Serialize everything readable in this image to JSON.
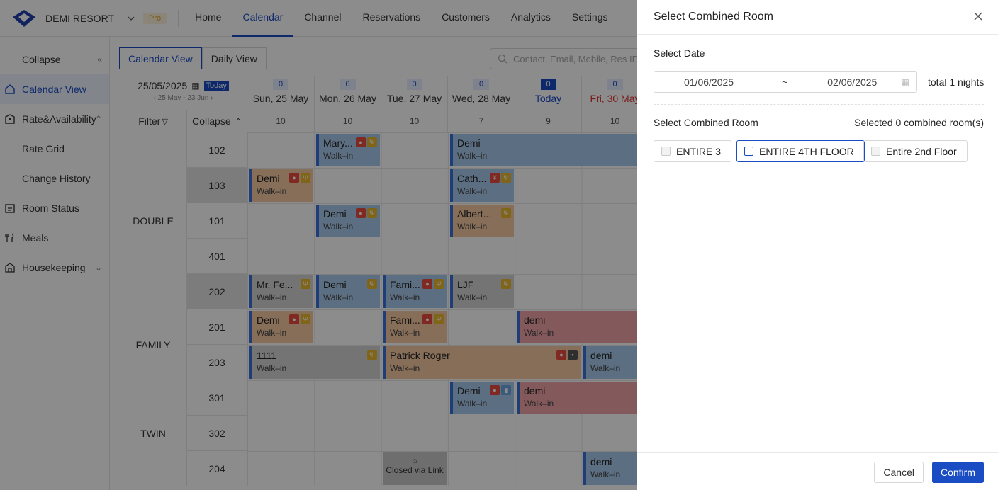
{
  "app": {
    "brand": "DEMI RESORT",
    "pro_badge": "Pro"
  },
  "nav": [
    "Home",
    "Calendar",
    "Channel",
    "Reservations",
    "Customers",
    "Analytics",
    "Settings"
  ],
  "sidebar": {
    "collapse": "Collapse",
    "items": [
      "Calendar View",
      "Rate&Availability",
      "Rate Grid",
      "Change History",
      "Room Status",
      "Meals",
      "Housekeeping"
    ]
  },
  "toolbar": {
    "calendar_view": "Calendar View",
    "daily_view": "Daily View",
    "search_placeholder": "Contact, Email, Mobile, Res ID"
  },
  "calendar": {
    "current_date": "25/05/2025",
    "today_btn": "Today",
    "range": "25 May - 23 Jun",
    "filter": "Filter",
    "collapse": "Collapse",
    "days": [
      {
        "count": "0",
        "label": "Sun, 25 May",
        "avail": "10"
      },
      {
        "count": "0",
        "label": "Mon, 26 May",
        "avail": "10"
      },
      {
        "count": "0",
        "label": "Tue, 27 May",
        "avail": "10"
      },
      {
        "count": "0",
        "label": "Wed, 28 May",
        "avail": "7"
      },
      {
        "count": "0",
        "label": "Today",
        "avail": "9"
      },
      {
        "count": "0",
        "label": "Fri, 30 May",
        "avail": "10"
      }
    ],
    "room_types": [
      "DOUBLE",
      "FAMILY",
      "TWIN"
    ],
    "rooms": [
      "102",
      "103",
      "101",
      "401",
      "202",
      "201",
      "203",
      "301",
      "302",
      "204"
    ],
    "walk_in": "Walk–in",
    "bookings": {
      "b1": "Mary...",
      "b2": "Demi",
      "b3": "Demi",
      "b4": "Cath...",
      "b5": "Demi",
      "b6": "Albert...",
      "b7": "Mr. Fe...",
      "b8": "Demi",
      "b9": "Fami...",
      "b10": "LJF",
      "b11": "Demi",
      "b12": "Fami...",
      "b13": "demi",
      "b14": "1111",
      "b15": "Patrick Roger",
      "b16": "demi",
      "b17": "Demi",
      "b18": "demi",
      "b19": "demi"
    },
    "closed": "Closed via Link"
  },
  "drawer": {
    "title": "Select Combined Room",
    "select_date": "Select Date",
    "start_date": "01/06/2025",
    "tilde": "~",
    "end_date": "02/06/2025",
    "nights": "total 1 nights",
    "select_room": "Select Combined Room",
    "selected_count": "Selected 0 combined room(s)",
    "rooms": [
      "ENTIRE 3",
      "ENTIRE 4TH FLOOR",
      "Entire 2nd Floor"
    ],
    "cancel": "Cancel",
    "confirm": "Confirm"
  },
  "colors": {
    "accent": "#1a4cc4",
    "overlay": "rgba(0,0,0,0.45)"
  }
}
